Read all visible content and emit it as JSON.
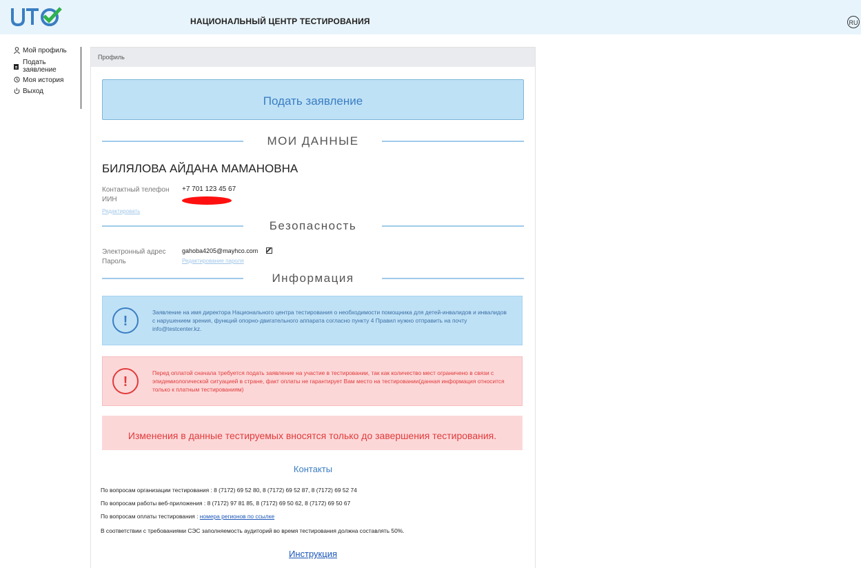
{
  "header": {
    "site_title": "НАЦИОНАЛЬНЫЙ ЦЕНТР ТЕСТИРОВАНИЯ",
    "lang": "RU"
  },
  "sidebar": {
    "items": [
      {
        "label": "Мой профиль",
        "icon": "user-icon"
      },
      {
        "label": "Подать заявление",
        "icon": "file-icon"
      },
      {
        "label": "Моя история",
        "icon": "history-icon"
      },
      {
        "label": "Выход",
        "icon": "power-icon"
      }
    ]
  },
  "breadcrumb": "Профиль",
  "apply_button": "Подать заявление",
  "sections": {
    "my_data": "МОИ ДАННЫЕ",
    "security": "Безопасность",
    "info": "Информация"
  },
  "profile": {
    "full_name": "БИЛЯЛОВА АЙДАНА МАМАНОВНА",
    "phone_label": "Контактный телефон",
    "phone_value": "+7 701 123 45 67",
    "iin_label": "ИИН",
    "edit_link": "Редактировать"
  },
  "security": {
    "email_label": "Электронный адрес",
    "email_value": "gahoba4205@mayhco.com",
    "password_label": "Пароль",
    "password_edit_link": "Редактирование пароля"
  },
  "alerts": {
    "info": "Заявление на имя директора Национального центра тестирования о необходимости помощника для детей-инвалидов и инвалидов с нарушением зрения, функций опорно-двигательного аппарата согласно пункту 4 Правил нужно отправить на почту info@testcenter.kz.",
    "danger": "Перед оплатой сначала требуется подать заявление на участие в тестировании, так как количество мест ограничено в связи с эпидемиологической ситуацией в стране, факт оплаты не гарантирует Вам место на тестировании(данная информация относится только к платным тестированиям)",
    "notice": "Изменения в данные тестируемых вносятся только до завершения тестирования."
  },
  "contacts": {
    "title": "Контакты",
    "line1": "По вопросам организации тестирования : 8 (7172) 69 52 80, 8 (7172) 69 52 87, 8 (7172) 69 52 74",
    "line2": "По вопросам работы веб-приложения : 8 (7172) 97 81 85, 8 (7172) 69 50 62, 8 (7172) 69 50 67",
    "line3_prefix": "По вопросам оплаты тестирования : ",
    "line3_link": "номера регионов по ссылке",
    "line4": "В соответствии с требованиями СЭС заполняемость аудиторий во время тестирования должна составлять 50%."
  },
  "instruction_link": "Инструкция",
  "colors": {
    "accent": "#3a7ec2",
    "header_bg": "#e8f4fb",
    "danger": "#e03b3b",
    "logo_green": "#2fb34a"
  }
}
